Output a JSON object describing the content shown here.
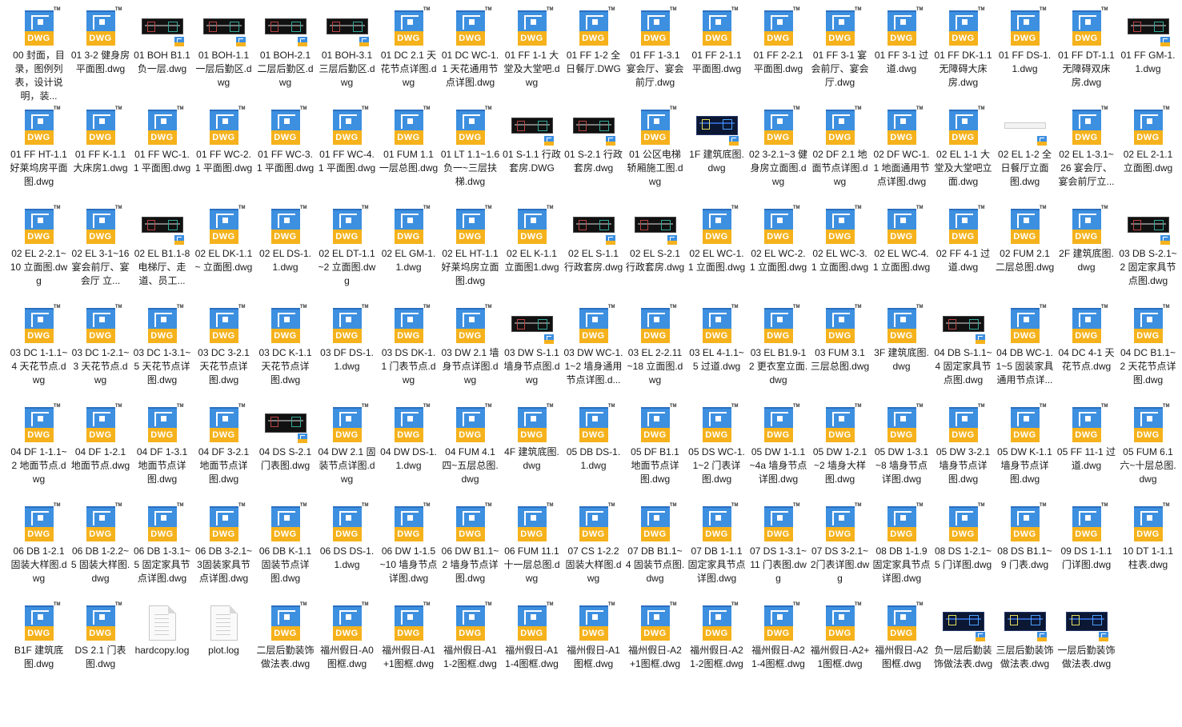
{
  "files": [
    {
      "name": "00 封面，目录，图例列表，设计说明，装...",
      "type": "dwg"
    },
    {
      "name": "01 3-2 健身房平面图.dwg",
      "type": "dwg"
    },
    {
      "name": "01 BOH B1.1 负一层.dwg",
      "type": "preview"
    },
    {
      "name": "01 BOH-1.1 一层后勤区.dwg",
      "type": "preview"
    },
    {
      "name": "01 BOH-2.1 二层后勤区.dwg",
      "type": "preview"
    },
    {
      "name": "01 BOH-3.1 三层后勤区.dwg",
      "type": "preview"
    },
    {
      "name": "01 DC 2.1 天花节点详图.dwg",
      "type": "dwg"
    },
    {
      "name": "01 DC WC-1.1 天花通用节点详图.dwg",
      "type": "dwg"
    },
    {
      "name": "01 FF 1-1 大堂及大堂吧.dwg",
      "type": "dwg"
    },
    {
      "name": "01 FF 1-2 全日餐厅.DWG",
      "type": "dwg"
    },
    {
      "name": "01 FF 1-3.1 宴会厅、宴会前厅.dwg",
      "type": "dwg"
    },
    {
      "name": "01 FF 2-1.1 平面图.dwg",
      "type": "dwg"
    },
    {
      "name": "01 FF 2-2.1 平面图.dwg",
      "type": "dwg"
    },
    {
      "name": "01 FF 3-1 宴会前厅、宴会厅.dwg",
      "type": "dwg"
    },
    {
      "name": "01 FF 3-1 过道.dwg",
      "type": "dwg"
    },
    {
      "name": "01 FF DK-1.1 无障碍大床房.dwg",
      "type": "dwg"
    },
    {
      "name": "01 FF DS-1.1.dwg",
      "type": "dwg"
    },
    {
      "name": "01 FF DT-1.1 无障碍双床房.dwg",
      "type": "dwg"
    },
    {
      "name": "01 FF GM-1.1.dwg",
      "type": "preview"
    },
    {
      "name": "01 FF HT-1.1 好莱坞房平面图.dwg",
      "type": "dwg"
    },
    {
      "name": "01 FF K-1.1 大床房1.dwg",
      "type": "dwg"
    },
    {
      "name": "01 FF WC-1.1 平面图.dwg",
      "type": "dwg"
    },
    {
      "name": "01 FF WC-2.1 平面图.dwg",
      "type": "dwg"
    },
    {
      "name": "01 FF WC-3.1 平面图.dwg",
      "type": "dwg"
    },
    {
      "name": "01 FF WC-4.1 平面图.dwg",
      "type": "dwg"
    },
    {
      "name": "01 FUM 1.1 一层总图.dwg",
      "type": "dwg"
    },
    {
      "name": "01 LT 1.1~1.6 负一~三层扶梯.dwg",
      "type": "dwg"
    },
    {
      "name": "01 S-1.1 行政套房.DWG",
      "type": "preview"
    },
    {
      "name": "01 S-2.1 行政套房.dwg",
      "type": "preview"
    },
    {
      "name": "01 公区电梯轿厢施工图.dwg",
      "type": "dwg"
    },
    {
      "name": "1F 建筑底图.dwg",
      "type": "preview-blue"
    },
    {
      "name": "02 3-2.1~3 健身房立面图.dwg",
      "type": "dwg"
    },
    {
      "name": "02 DF 2.1 地面节点详图.dwg",
      "type": "dwg"
    },
    {
      "name": "02 DF WC-1.1 地面通用节点详图.dwg",
      "type": "dwg"
    },
    {
      "name": "02 EL 1-1 大堂及大堂吧立面.dwg",
      "type": "dwg"
    },
    {
      "name": "02 EL 1-2 全日餐厅立面图.dwg",
      "type": "preview-light"
    },
    {
      "name": "02 EL 1-3.1~26 宴会厅、宴会前厅立...",
      "type": "dwg"
    },
    {
      "name": "02 EL 2-1.1 立面图.dwg",
      "type": "dwg"
    },
    {
      "name": "02 EL 2-2.1~10 立面图.dwg",
      "type": "dwg"
    },
    {
      "name": "02 EL 3-1~16 宴会前厅、宴会厅 立...",
      "type": "dwg"
    },
    {
      "name": "02 EL B1.1-8 电梯厅、走道、员工...",
      "type": "preview"
    },
    {
      "name": "02 EL DK-1.1 ~ 立面图.dwg",
      "type": "dwg"
    },
    {
      "name": "02 EL DS-1.1.dwg",
      "type": "dwg"
    },
    {
      "name": "02 EL DT-1.1 ~2 立面图.dwg",
      "type": "dwg"
    },
    {
      "name": "02 EL GM-1.1.dwg",
      "type": "dwg"
    },
    {
      "name": "02 EL HT-1.1 好莱坞房立面图.dwg",
      "type": "dwg"
    },
    {
      "name": "02 EL K-1.1 立面图1.dwg",
      "type": "dwg"
    },
    {
      "name": "02 EL S-1.1 行政套房.dwg",
      "type": "preview"
    },
    {
      "name": "02 EL S-2.1 行政套房.dwg",
      "type": "preview"
    },
    {
      "name": "02 EL WC-1.1 立面图.dwg",
      "type": "dwg"
    },
    {
      "name": "02 EL WC-2.1 立面图.dwg",
      "type": "dwg"
    },
    {
      "name": "02 EL WC-3.1 立面图.dwg",
      "type": "dwg"
    },
    {
      "name": "02 EL WC-4.1 立面图.dwg",
      "type": "dwg"
    },
    {
      "name": "02 FF 4-1 过道.dwg",
      "type": "dwg"
    },
    {
      "name": "02 FUM 2.1 二层总图.dwg",
      "type": "dwg"
    },
    {
      "name": "2F 建筑底图.dwg",
      "type": "dwg"
    },
    {
      "name": "03 DB S-2.1~2 固定家具节点图.dwg",
      "type": "preview"
    },
    {
      "name": "03 DC 1-1.1~4 天花节点.dwg",
      "type": "dwg"
    },
    {
      "name": "03 DC 1-2.1~3 天花节点.dwg",
      "type": "dwg"
    },
    {
      "name": "03 DC 1-3.1~5 天花节点详图.dwg",
      "type": "dwg"
    },
    {
      "name": "03 DC 3-2.1天花节点详图.dwg",
      "type": "dwg"
    },
    {
      "name": "03 DC K-1.1 天花节点详图.dwg",
      "type": "dwg"
    },
    {
      "name": "03 DF DS-1.1.dwg",
      "type": "dwg"
    },
    {
      "name": "03 DS DK-1.1 门表节点.dwg",
      "type": "dwg"
    },
    {
      "name": "03 DW 2.1 墙身节点详图.dwg",
      "type": "dwg"
    },
    {
      "name": "03 DW S-1.1 墙身节点图.dwg",
      "type": "preview"
    },
    {
      "name": "03 DW WC-1.1~2 墙身通用节点详图.d...",
      "type": "dwg"
    },
    {
      "name": "03 EL 2-2.11~18 立面图.dwg",
      "type": "dwg"
    },
    {
      "name": "03 EL 4-1.1~5 过道.dwg",
      "type": "dwg"
    },
    {
      "name": "03 EL B1.9-12 更衣室立面.dwg",
      "type": "dwg"
    },
    {
      "name": "03 FUM 3.1 三层总图.dwg",
      "type": "dwg"
    },
    {
      "name": "3F 建筑底图.dwg",
      "type": "dwg"
    },
    {
      "name": "04 DB S-1.1~4 固定家具节点图.dwg",
      "type": "preview"
    },
    {
      "name": "04 DB WC-1.1~5 固装家具通用节点详...",
      "type": "dwg"
    },
    {
      "name": "04 DC 4-1 天花节点.dwg",
      "type": "dwg"
    },
    {
      "name": "04 DC B1.1~2 天花节点详图.dwg",
      "type": "dwg"
    },
    {
      "name": "04 DF 1-1.1~2 地面节点.dwg",
      "type": "dwg"
    },
    {
      "name": "04 DF 1-2.1 地面节点.dwg",
      "type": "dwg"
    },
    {
      "name": "04 DF 1-3.1 地面节点详图.dwg",
      "type": "dwg"
    },
    {
      "name": "04 DF 3-2.1 地面节点详图.dwg",
      "type": "dwg"
    },
    {
      "name": "04 DS S-2.1 门表图.dwg",
      "type": "preview-light2"
    },
    {
      "name": "04 DW 2.1 固装节点详图.dwg",
      "type": "dwg"
    },
    {
      "name": "04 DW DS-1.1.dwg",
      "type": "dwg"
    },
    {
      "name": "04 FUM 4.1 四~五层总图.dwg",
      "type": "dwg"
    },
    {
      "name": "4F 建筑底图.dwg",
      "type": "dwg"
    },
    {
      "name": "05 DB DS-1.1.dwg",
      "type": "dwg"
    },
    {
      "name": "05 DF B1.1 地面节点详图.dwg",
      "type": "dwg"
    },
    {
      "name": "05 DS WC-1.1~2 门表详图.dwg",
      "type": "dwg"
    },
    {
      "name": "05 DW 1-1.1~4a 墙身节点详图.dwg",
      "type": "dwg"
    },
    {
      "name": "05 DW 1-2.1~2 墙身大样图.dwg",
      "type": "dwg"
    },
    {
      "name": "05 DW 1-3.1~8 墙身节点详图.dwg",
      "type": "dwg"
    },
    {
      "name": "05 DW 3-2.1 墙身节点详图.dwg",
      "type": "dwg"
    },
    {
      "name": "05 DW K-1.1 墙身节点详图.dwg",
      "type": "dwg"
    },
    {
      "name": "05 FF 11-1 过道.dwg",
      "type": "dwg"
    },
    {
      "name": "05 FUM 6.1 六~十层总图.dwg",
      "type": "dwg"
    },
    {
      "name": "06 DB 1-2.1 固装大样图.dwg",
      "type": "dwg"
    },
    {
      "name": "06 DB 1-2.2~5 固装大样图.dwg",
      "type": "dwg"
    },
    {
      "name": "06 DB 1-3.1~5 固定家具节点详图.dwg",
      "type": "dwg"
    },
    {
      "name": "06 DB 3-2.1~3固装家具节点详图.dwg",
      "type": "dwg"
    },
    {
      "name": "06 DB K-1.1 固装节点详图.dwg",
      "type": "dwg"
    },
    {
      "name": "06 DS DS-1.1.dwg",
      "type": "dwg"
    },
    {
      "name": "06 DW 1-1.5~10 墙身节点详图.dwg",
      "type": "dwg"
    },
    {
      "name": "06 DW B1.1~2 墙身节点详图.dwg",
      "type": "dwg"
    },
    {
      "name": "06 FUM 11.1 十一层总图.dwg",
      "type": "dwg"
    },
    {
      "name": "07 CS 1-2.2 固装大样图.dwg",
      "type": "dwg"
    },
    {
      "name": "07 DB B1.1~4 固装节点图.dwg",
      "type": "dwg"
    },
    {
      "name": "07 DB 1-1.1 固定家具节点详图.dwg",
      "type": "dwg"
    },
    {
      "name": "07 DS 1-3.1~11 门表图.dwg",
      "type": "dwg"
    },
    {
      "name": "07 DS 3-2.1~2门表详图.dwg",
      "type": "dwg"
    },
    {
      "name": "08 DB 1-1.9 固定家具节点详图.dwg",
      "type": "dwg"
    },
    {
      "name": "08 DS 1-2.1~5 门详图.dwg",
      "type": "dwg"
    },
    {
      "name": "08 DS B1.1~9 门表.dwg",
      "type": "dwg"
    },
    {
      "name": "09 DS 1-1.1 门详图.dwg",
      "type": "dwg"
    },
    {
      "name": "10 DT 1-1.1 柱表.dwg",
      "type": "dwg"
    },
    {
      "name": "B1F 建筑底图.dwg",
      "type": "dwg"
    },
    {
      "name": "DS 2.1 门表图.dwg",
      "type": "dwg"
    },
    {
      "name": "hardcopy.log",
      "type": "text"
    },
    {
      "name": "plot.log",
      "type": "text"
    },
    {
      "name": "二层后勤装饰做法表.dwg",
      "type": "dwg"
    },
    {
      "name": "福州假日-A0图框.dwg",
      "type": "dwg"
    },
    {
      "name": "福州假日-A1 +1图框.dwg",
      "type": "dwg"
    },
    {
      "name": "福州假日-A1 1-2图框.dwg",
      "type": "dwg"
    },
    {
      "name": "福州假日-A1 1-4图框.dwg",
      "type": "dwg"
    },
    {
      "name": "福州假日-A1图框.dwg",
      "type": "dwg"
    },
    {
      "name": "福州假日-A2 +1图框.dwg",
      "type": "dwg"
    },
    {
      "name": "福州假日-A2 1-2图框.dwg",
      "type": "dwg"
    },
    {
      "name": "福州假日-A2 1-4图框.dwg",
      "type": "dwg"
    },
    {
      "name": "福州假日-A2+1图框.dwg",
      "type": "dwg"
    },
    {
      "name": "福州假日-A2图框.dwg",
      "type": "dwg"
    },
    {
      "name": "负一层后勤装饰做法表.dwg",
      "type": "preview-blue"
    },
    {
      "name": "三层后勤装饰做法表.dwg",
      "type": "preview-blue"
    },
    {
      "name": "一层后勤装饰做法表.dwg",
      "type": "preview-blue"
    }
  ],
  "icon_label": "DWG",
  "colors": {
    "dwg_blue": "#3d8fe0",
    "dwg_yellow": "#f5b21c",
    "text": "#1a1a1a",
    "background": "#ffffff"
  }
}
